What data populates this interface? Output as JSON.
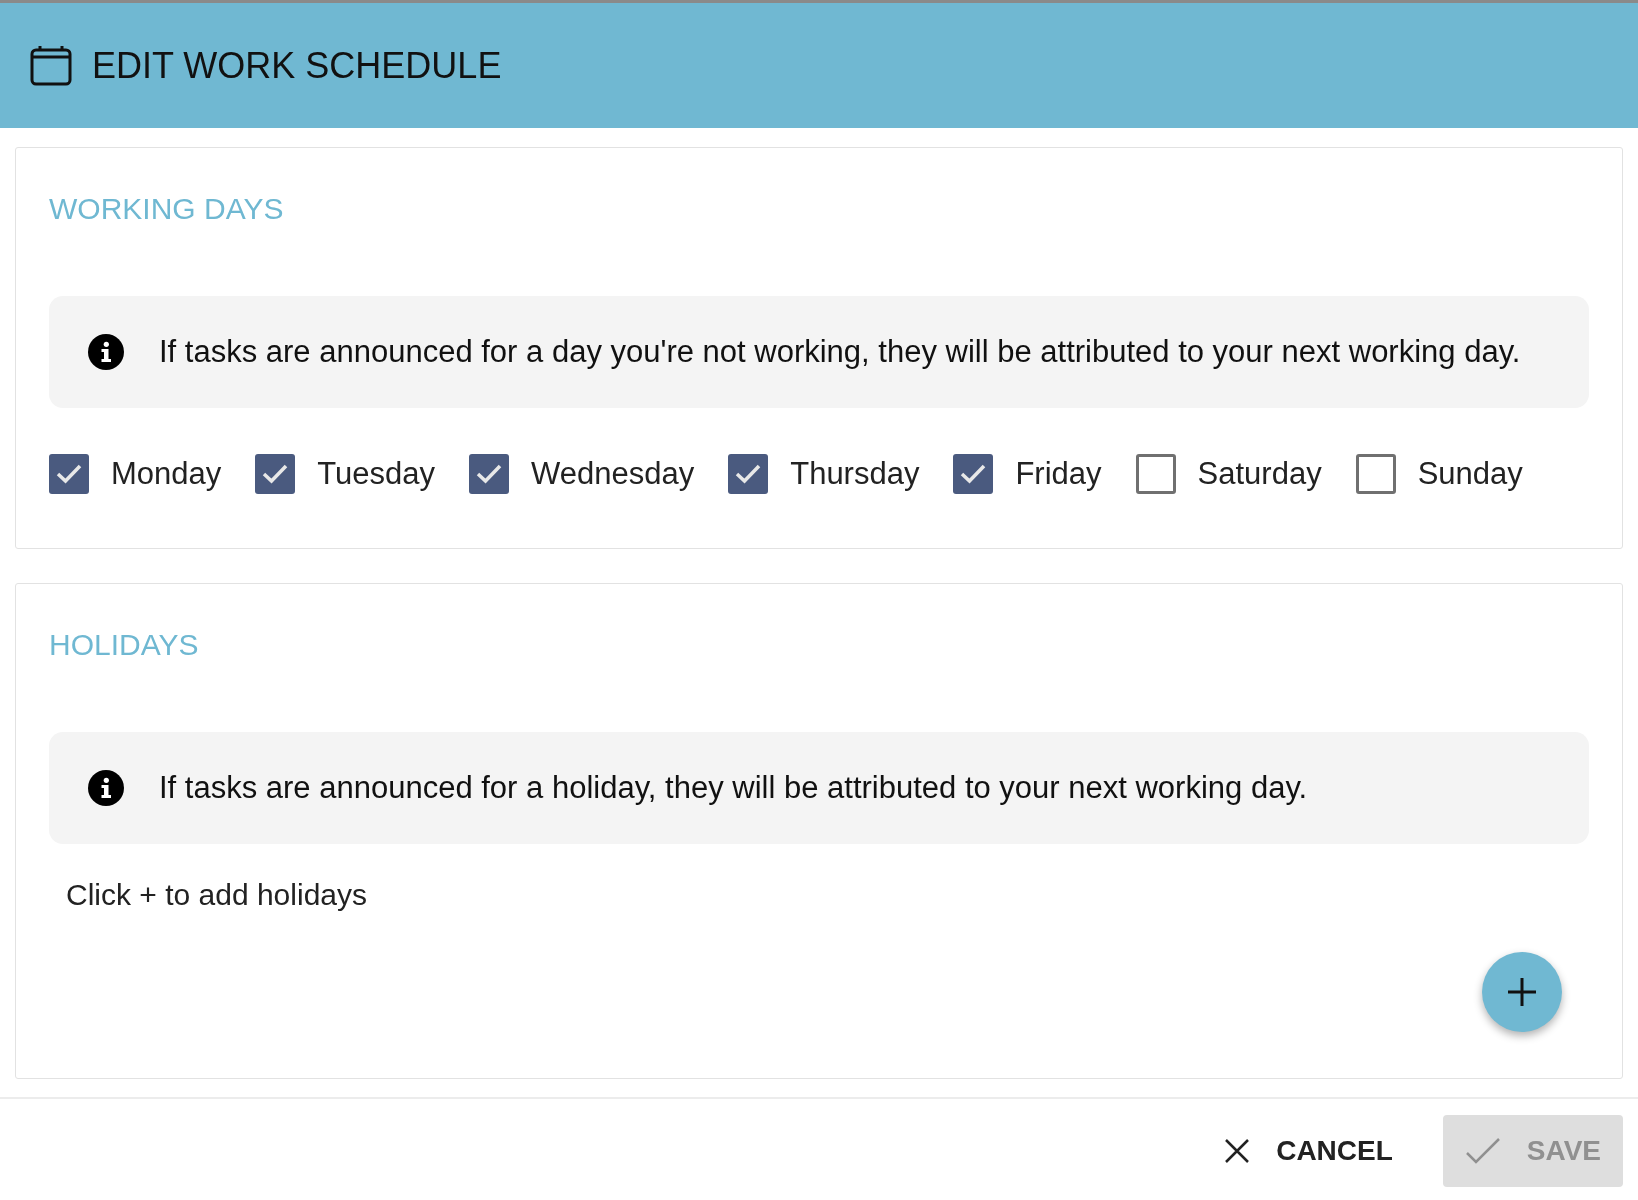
{
  "dialog": {
    "title": "EDIT WORK SCHEDULE"
  },
  "working_days": {
    "heading": "WORKING DAYS",
    "info": "If tasks are announced for a day you're not working, they will be attributed to your next working day.",
    "days": [
      {
        "label": "Monday",
        "checked": true
      },
      {
        "label": "Tuesday",
        "checked": true
      },
      {
        "label": "Wednesday",
        "checked": true
      },
      {
        "label": "Thursday",
        "checked": true
      },
      {
        "label": "Friday",
        "checked": true
      },
      {
        "label": "Saturday",
        "checked": false
      },
      {
        "label": "Sunday",
        "checked": false
      }
    ]
  },
  "holidays": {
    "heading": "HOLIDAYS",
    "info": "If tasks are announced for a holiday, they will be attributed to your next working day.",
    "empty_hint": "Click + to add holidays"
  },
  "buttons": [
    {
      "kind": "cancel",
      "label": "CANCEL",
      "disabled": false
    },
    {
      "kind": "save",
      "label": "SAVE",
      "disabled": true
    }
  ]
}
